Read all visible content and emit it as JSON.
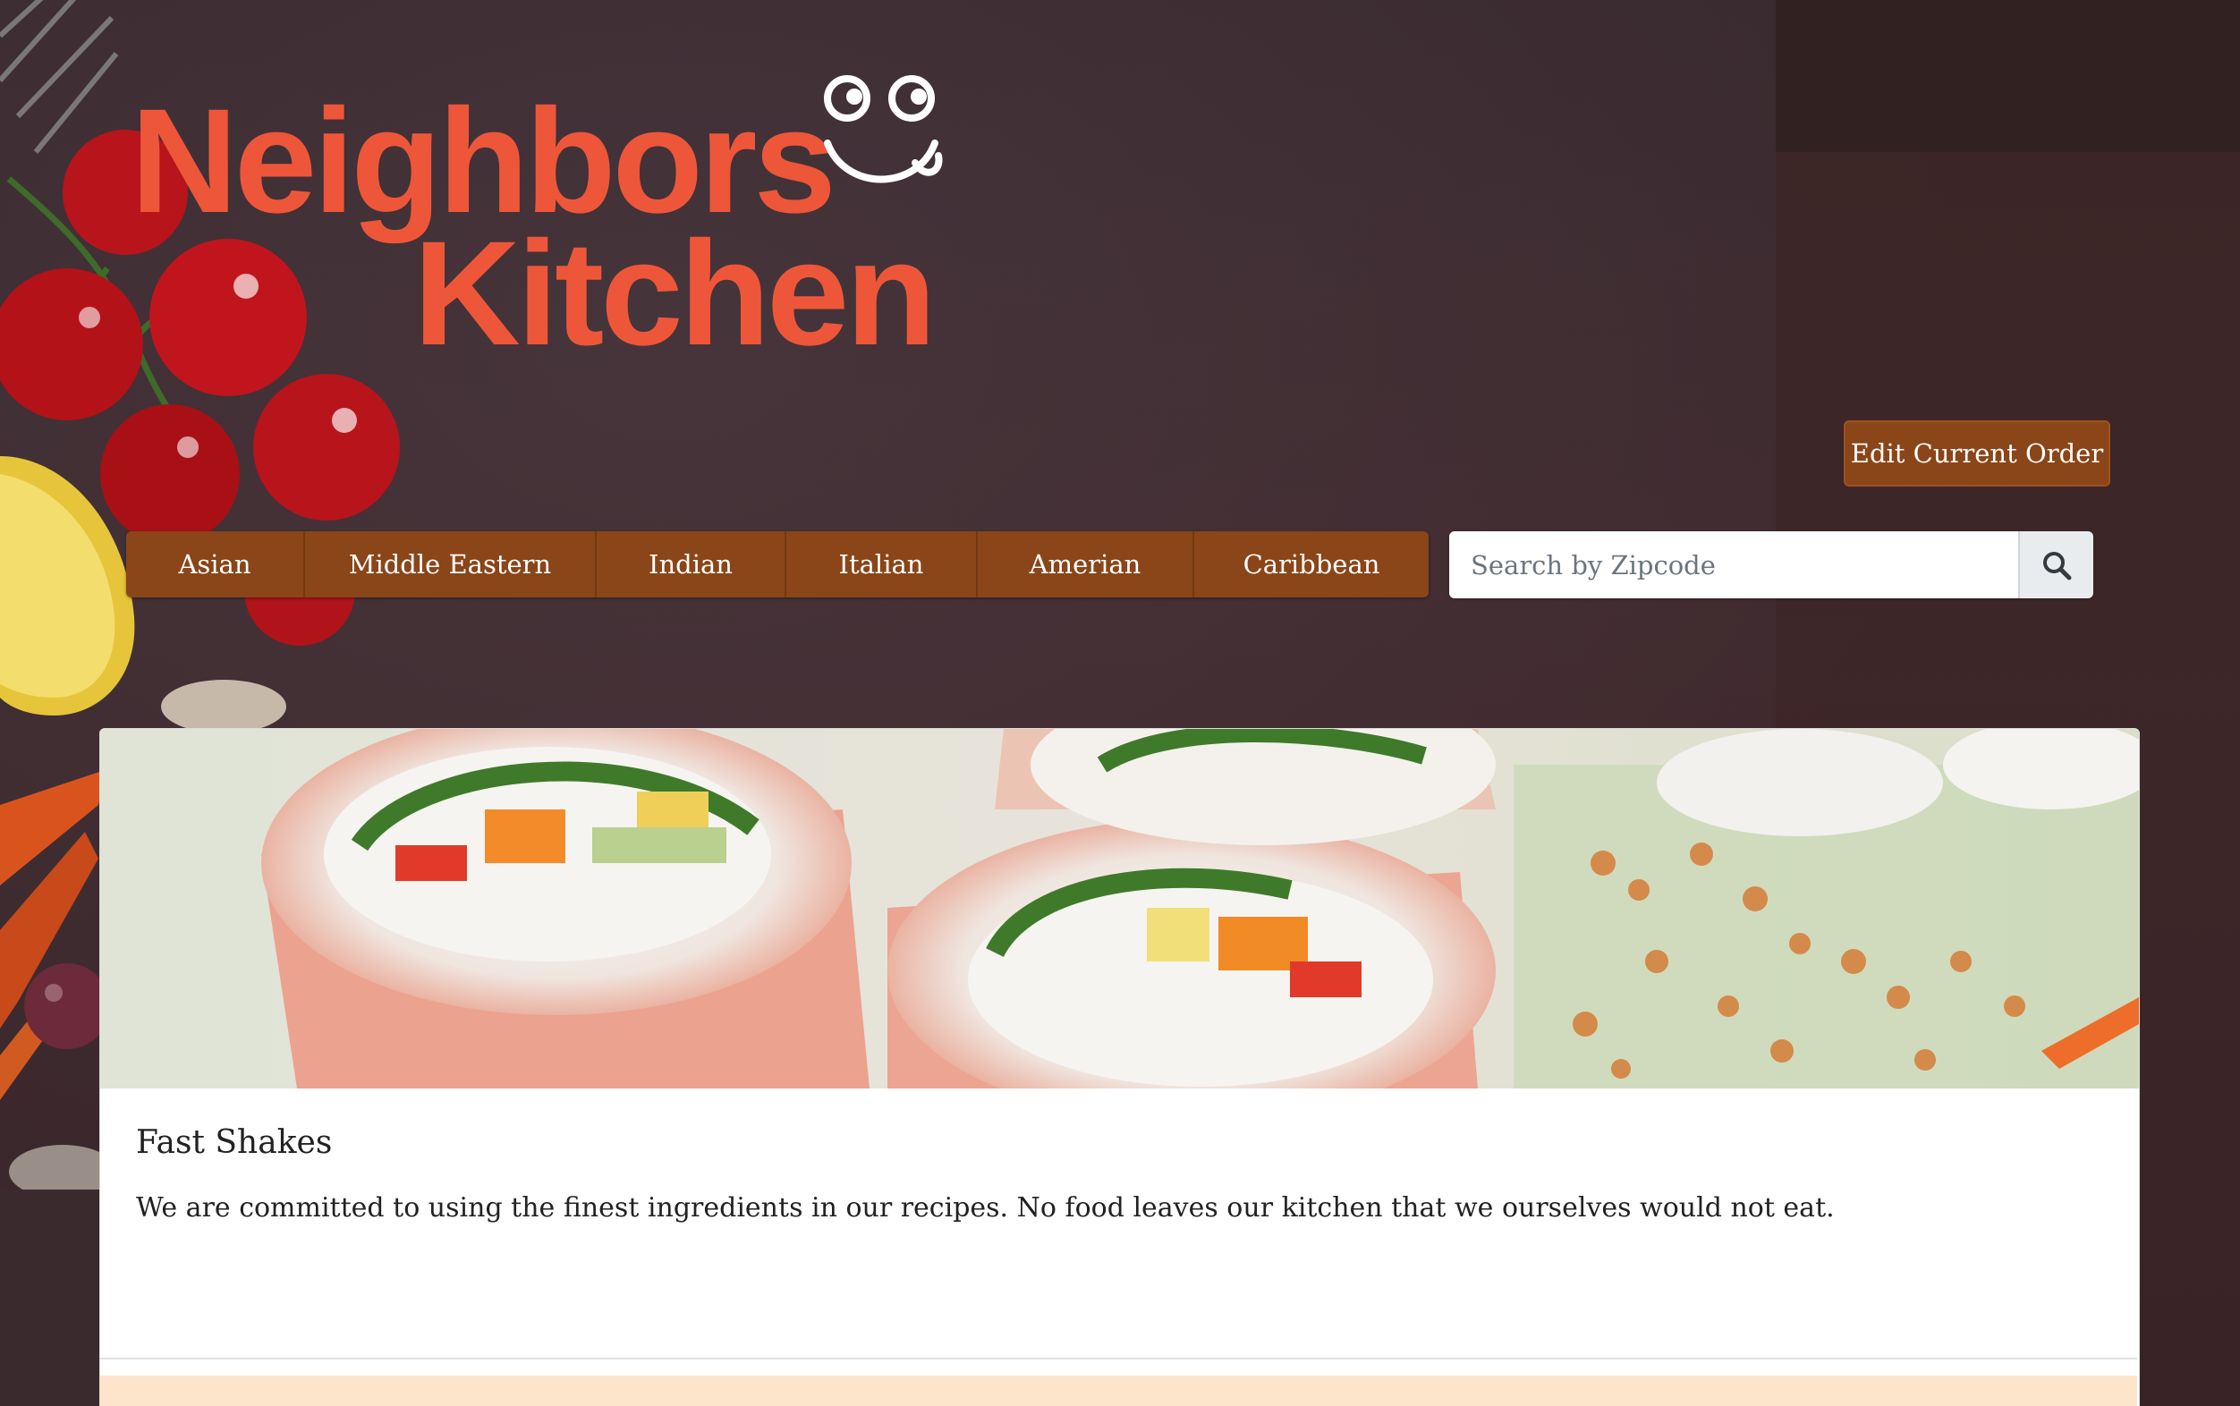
{
  "brand": {
    "line1": "Neighbors",
    "line2": "Kitchen",
    "color": "#ee5639",
    "face_icon": "smiley-face-tongue-icon"
  },
  "header": {
    "edit_order_label": "Edit Current Order"
  },
  "nav": {
    "items": [
      {
        "label": "Asian"
      },
      {
        "label": "Middle Eastern"
      },
      {
        "label": "Indian"
      },
      {
        "label": "Italian"
      },
      {
        "label": "Amerian"
      },
      {
        "label": "Caribbean"
      }
    ],
    "button_color": "#8a4518"
  },
  "search": {
    "placeholder": "Search by Zipcode",
    "button_icon": "search-icon"
  },
  "card": {
    "image_description_icon": "food-photo",
    "title": "Fast Shakes",
    "text": "We are committed to using the finest ingredients in our recipes. No food leaves our kitchen that we ourselves would not eat.",
    "footer_color": "#fde5cb"
  }
}
